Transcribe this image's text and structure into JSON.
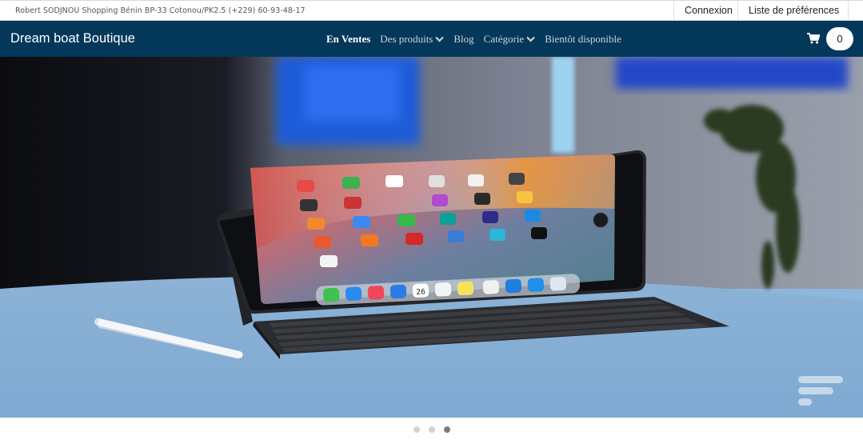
{
  "topbar": {
    "address": "Robert SODJNOU Shopping Bénin BP-33 Cotonou/PK2.5 (+229) 60-93-48-17",
    "login_label": "Connexion",
    "wishlist_label": "Liste de préférences"
  },
  "navbar": {
    "brand": "Dream boat Boutique",
    "items": [
      {
        "label": "En Ventes",
        "active": true,
        "has_dropdown": false
      },
      {
        "label": "Des produits",
        "active": false,
        "has_dropdown": true
      },
      {
        "label": "Blog",
        "active": false,
        "has_dropdown": false
      },
      {
        "label": "Catégorie",
        "active": false,
        "has_dropdown": true
      },
      {
        "label": "Bientôt disponible",
        "active": false,
        "has_dropdown": false
      }
    ],
    "cart_icon": "shopping-cart-icon",
    "cart_count": "0"
  },
  "hero": {
    "image_subject": "tablet with keyboard and stylus",
    "calendar_day": "26"
  },
  "carousel": {
    "slide_count": 3,
    "active_index": 2
  },
  "colors": {
    "navbar_bg": "#04385a",
    "active_dot": "#777c80",
    "inactive_dot": "#d3d3d3"
  }
}
